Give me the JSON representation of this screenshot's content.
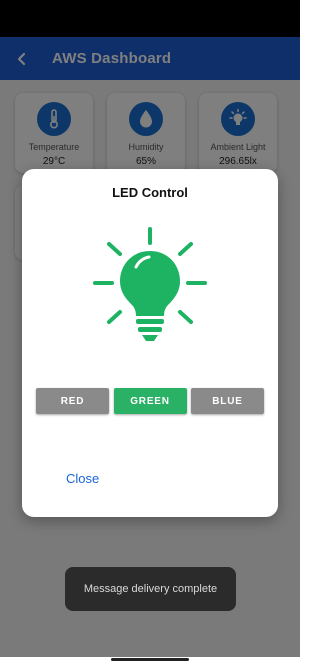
{
  "app_bar": {
    "title": "AWS Dashboard",
    "back_icon": "back-arrow-icon",
    "color": "#1f5fd6"
  },
  "sensors": [
    {
      "label": "Temperature",
      "value": "29°C",
      "icon": "thermometer-icon"
    },
    {
      "label": "Humidity",
      "value": "65%",
      "icon": "water-drop-icon"
    },
    {
      "label": "Ambient Light",
      "value": "296.65lx",
      "icon": "light-bulb-icon"
    }
  ],
  "dialog": {
    "title": "LED Control",
    "bulb_icon": "light-bulb-icon",
    "bulb_color": "#1db363",
    "colors": [
      {
        "label": "RED",
        "selected": false,
        "color": "#8a8a8a"
      },
      {
        "label": "GREEN",
        "selected": true,
        "color": "#2bb166"
      },
      {
        "label": "BLUE",
        "selected": false,
        "color": "#8a8a8a"
      }
    ],
    "close_label": "Close"
  },
  "toast": {
    "message": "Message delivery complete"
  }
}
